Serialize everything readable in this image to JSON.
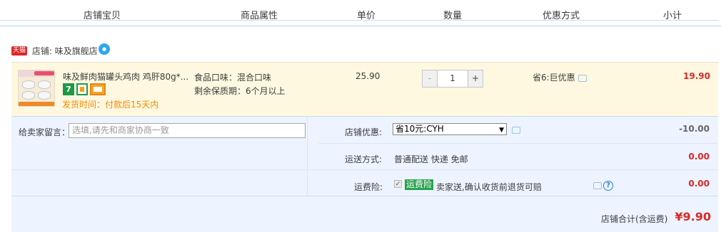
{
  "header": {
    "col_item": "店铺宝贝",
    "col_attr": "商品属性",
    "col_price": "单价",
    "col_qty": "数量",
    "col_discount": "优惠方式",
    "col_subtotal": "小计"
  },
  "shop": {
    "badge": "天猫",
    "label": "店铺: 味及旗舰店"
  },
  "item": {
    "title": "味及鲜肉猫罐头鸡肉 鸡肝80g*...",
    "badge_7": "7",
    "shipping": "发货时间：付款后15天内",
    "attr_flavor": "食品口味：混合口味",
    "attr_shelf": "剩余保质期：6个月以上",
    "price": "25.90",
    "qty_minus": "-",
    "quantity": "1",
    "qty_plus": "+",
    "discount": "省6:巨优惠",
    "subtotal": "19.90"
  },
  "order": {
    "message_label": "给卖家留言：",
    "message_placeholder": "选填,请先和商家协商一致",
    "coupon_label": "店铺优惠:",
    "coupon_selected": "省10元:CYH",
    "coupon_value": "-10.00",
    "shipping_label": "运送方式:",
    "shipping_method": "普通配送 快递 免邮",
    "shipping_value": "0.00",
    "insurance_label": "运费险:",
    "insurance_tag": "运费险",
    "insurance_desc": "卖家送,确认收货前退货可赔",
    "insurance_value": "0.00",
    "total_label": "店铺合计(含运费)",
    "total_value": "¥9.90"
  },
  "colors": {
    "accent_red": "#dd2727",
    "shipping_orange": "#f38a00",
    "panel_blue": "#edf4ff",
    "item_bg": "#fff8e1",
    "insurance_green": "#27a24f"
  }
}
